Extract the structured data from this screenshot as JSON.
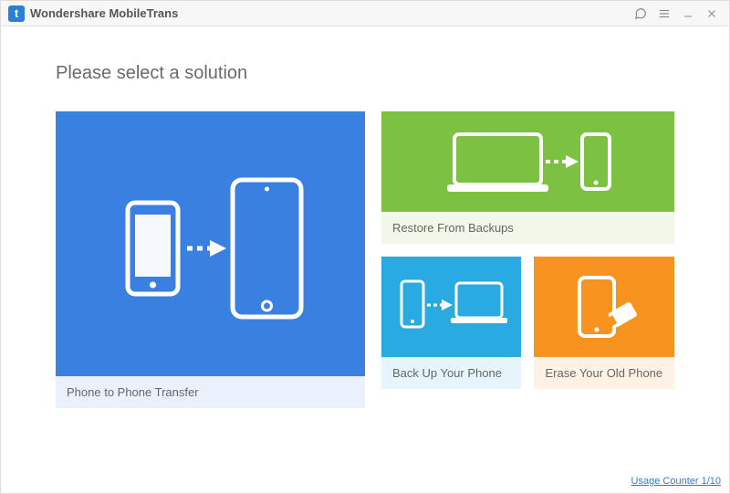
{
  "app": {
    "logo_letter": "t",
    "title": "Wondershare MobileTrans"
  },
  "heading": "Please select a solution",
  "tiles": {
    "phone_to_phone": "Phone to Phone Transfer",
    "restore": "Restore From Backups",
    "backup": "Back Up Your Phone",
    "erase": "Erase Your Old Phone"
  },
  "footer": {
    "usage_counter": "Usage Counter 1/10"
  },
  "colors": {
    "blue": "#3a80e0",
    "green": "#7cc142",
    "cyan": "#29abe2",
    "orange": "#f7931e"
  }
}
